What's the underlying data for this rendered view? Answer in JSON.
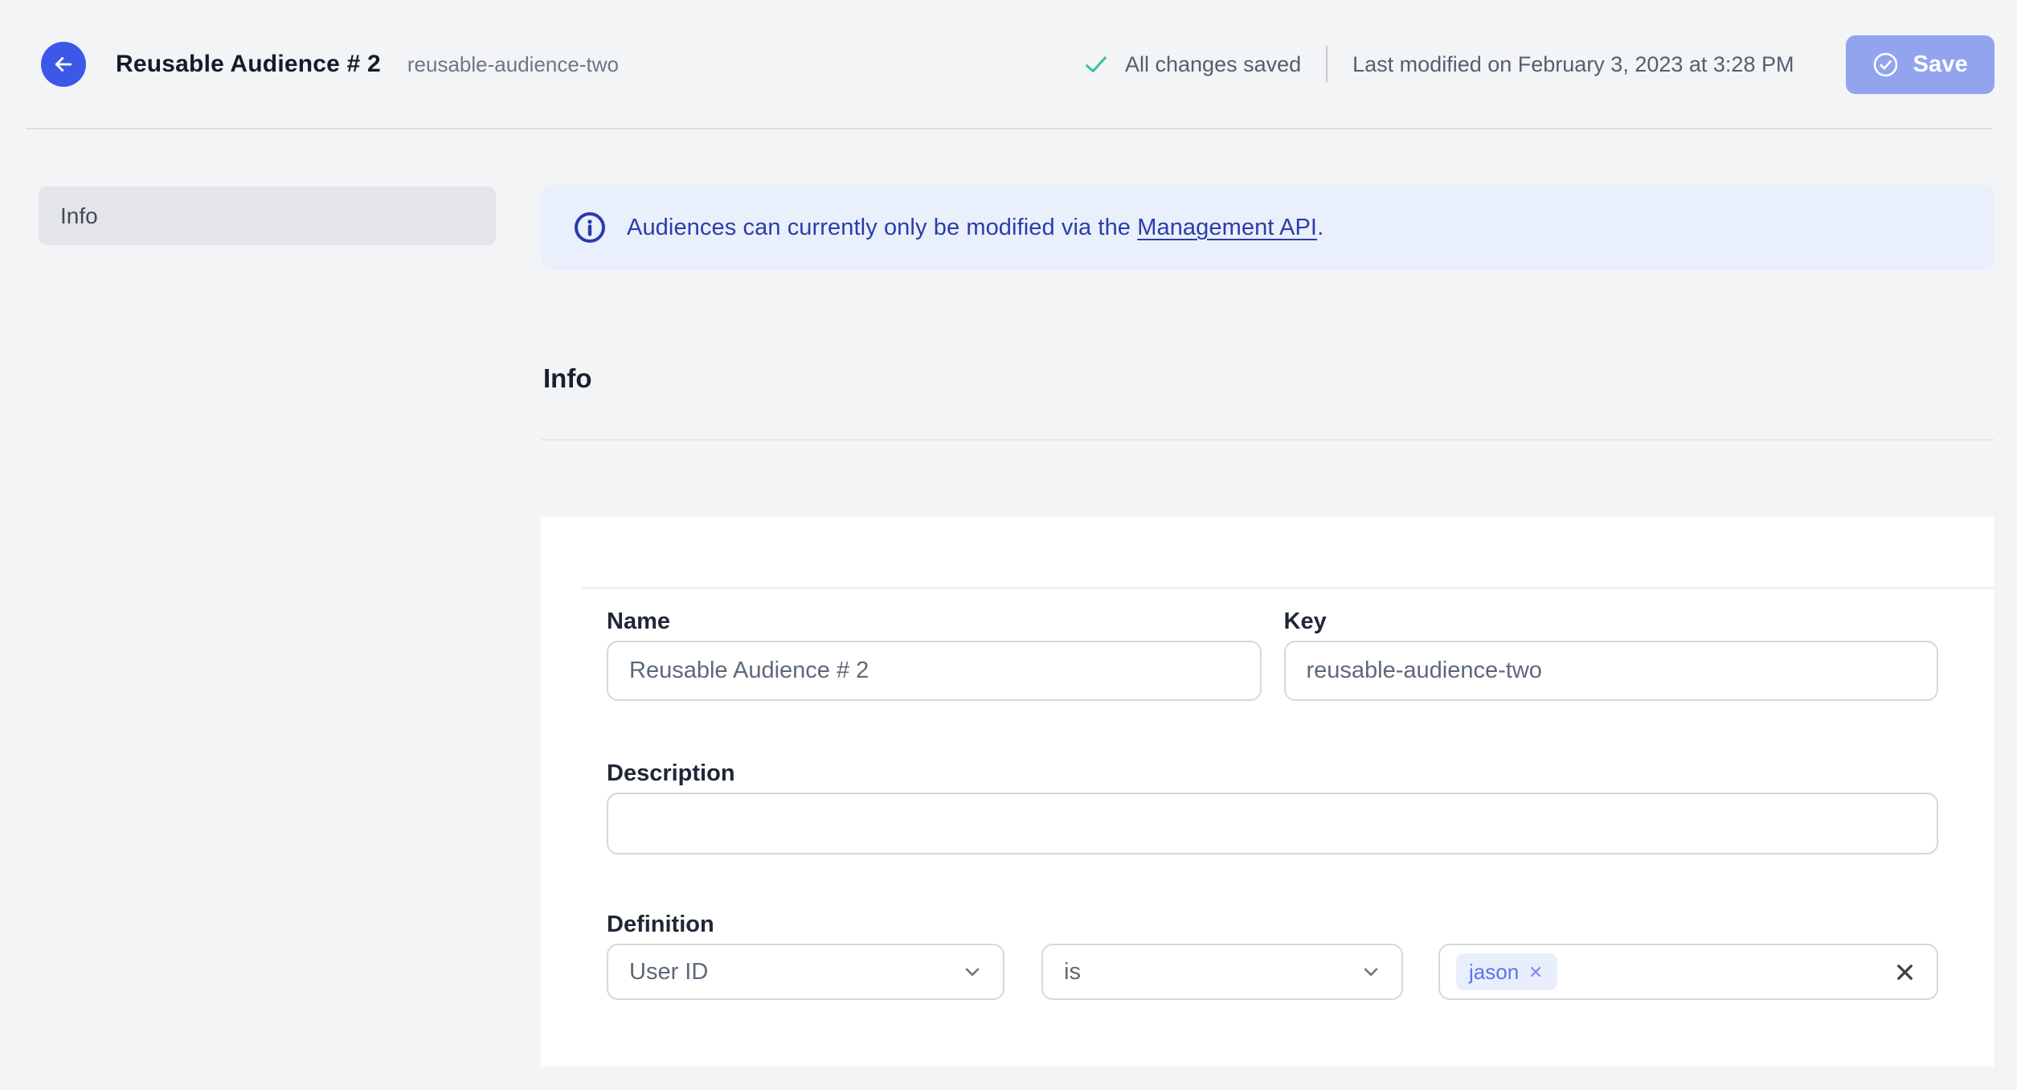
{
  "header": {
    "title": "Reusable Audience # 2",
    "subtitle": "reusable-audience-two",
    "saved_status": "All changes saved",
    "last_modified": "Last modified on February 3, 2023 at 3:28 PM",
    "save_label": "Save"
  },
  "sidebar": {
    "items": [
      {
        "label": "Info",
        "active": true
      }
    ]
  },
  "banner": {
    "text_before_link": "Audiences can currently only be modified via the ",
    "link_text": "Management API",
    "text_after_link": "."
  },
  "section": {
    "title": "Info"
  },
  "form": {
    "name": {
      "label": "Name",
      "value": "Reusable Audience # 2"
    },
    "key": {
      "label": "Key",
      "value": "reusable-audience-two"
    },
    "description": {
      "label": "Description",
      "value": ""
    },
    "definition": {
      "label": "Definition",
      "trait_selected": "User ID",
      "operator_selected": "is",
      "values": [
        "jason"
      ]
    }
  },
  "icons": {
    "back": "arrow-left",
    "saved": "check",
    "save": "check-circle",
    "banner": "info-circle",
    "dropdown": "chevron-down",
    "chip_remove": "x",
    "clear": "x"
  },
  "colors": {
    "brand_blue": "#3b58e9",
    "save_disabled_blue": "#92a4ee",
    "success_green": "#3ec09a",
    "banner_bg": "#e9f0fb",
    "banner_text": "#2b3cad",
    "page_bg": "#f3f4f6",
    "card_bg": "#ffffff",
    "input_border": "#d5d8de",
    "muted_text": "#5d6878",
    "chip_bg": "#e9eefc",
    "chip_text": "#5b76e8"
  }
}
